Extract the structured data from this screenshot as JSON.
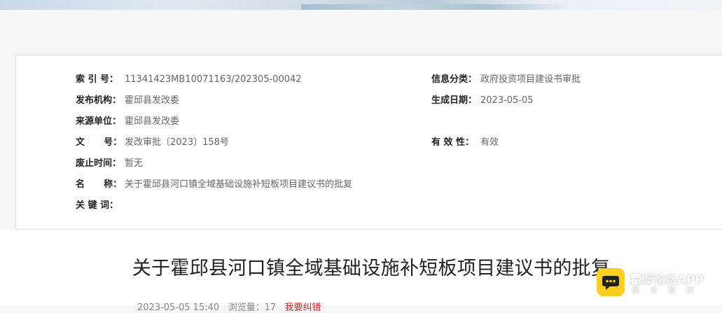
{
  "info": {
    "index_label": "索 引 号：",
    "index_value": "11341423MB10071163/202305-00042",
    "category_label": "信息分类：",
    "category_value": "政府投资项目建设书审批",
    "publisher_label": "发布机构：",
    "publisher_value": "霍邱县发改委",
    "date_label": "生成日期：",
    "date_value": "2023-05-05",
    "source_label": "来源单位：",
    "source_value": "霍邱县发改委",
    "docno_label": "文      号：",
    "docno_value": "发改审批〔2023〕158号",
    "validity_label": "有 效 性：",
    "validity_value": "有效",
    "expiry_label": "废止时间：",
    "expiry_value": "暂无",
    "name_label": "名      称：",
    "name_value": "关于霍邱县河口镇全域基础设施补短板项目建议书的批复",
    "keywords_label": "关 键 词：",
    "keywords_value": ""
  },
  "article": {
    "title": "关于霍邱县河口镇全域基础设施补短板项目建议书的批复",
    "meta_date": "2023-05-05 15:40",
    "meta_views": "浏览量：17",
    "meta_red": "我要纠错"
  },
  "app_badge": {
    "name": "霍邱论坛APP",
    "sub": "阅读霍邱"
  }
}
